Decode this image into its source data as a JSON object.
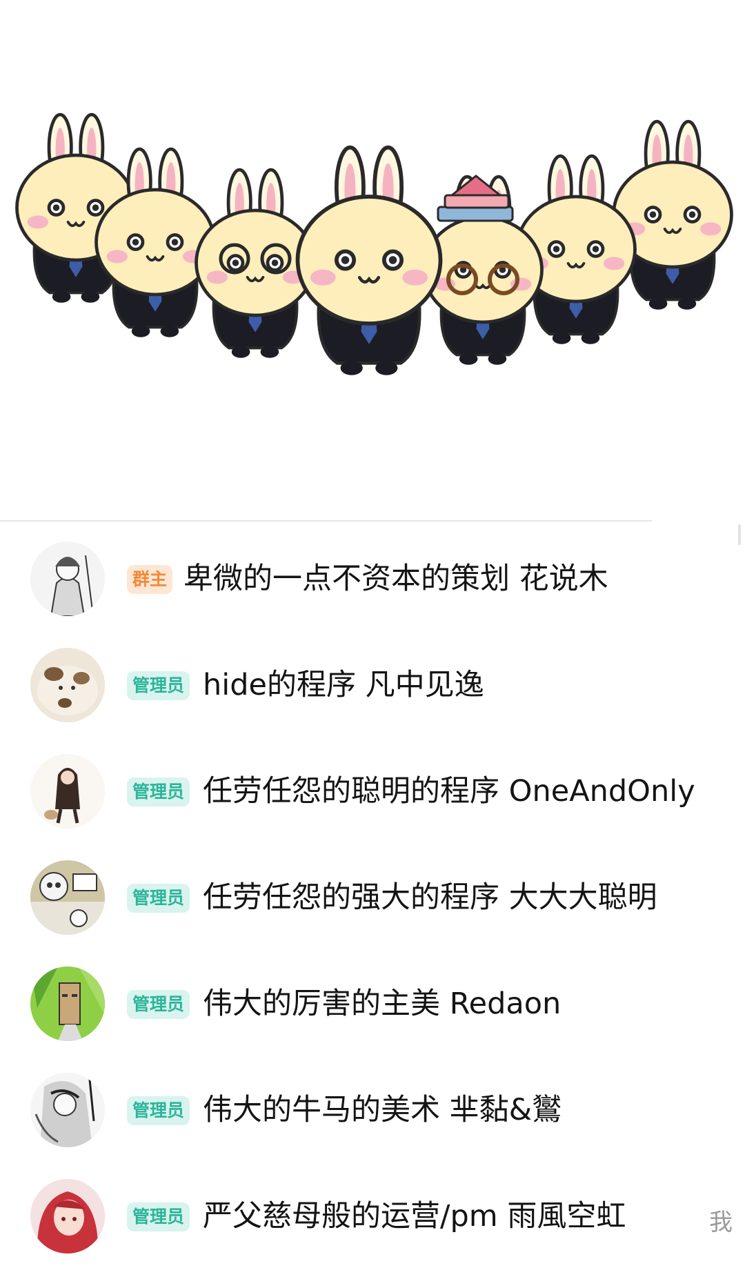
{
  "members": [
    {
      "badge": "群主",
      "badge_type": "owner",
      "name": "卑微的一点不资本的策划 花说木",
      "avatar": "sketch-guy-avatar"
    },
    {
      "badge": "管理员",
      "badge_type": "admin",
      "name": "hide的程序 凡中见逸",
      "avatar": "cat-avatar"
    },
    {
      "badge": "管理员",
      "badge_type": "admin",
      "name": "任劳任怨的聪明的程序 OneAndOnly",
      "avatar": "girl-with-cat-avatar"
    },
    {
      "badge": "管理员",
      "badge_type": "admin",
      "name": "任劳任怨的强大的程序 大大大聪明",
      "avatar": "comic-cat-avatar"
    },
    {
      "badge": "管理员",
      "badge_type": "admin",
      "name": "伟大的厉害的主美 Redaon",
      "avatar": "green-cartoon-avatar"
    },
    {
      "badge": "管理员",
      "badge_type": "admin",
      "name": "伟大的牛马的美术 芈黏&鸑",
      "avatar": "anime-sketch-avatar"
    },
    {
      "badge": "管理员",
      "badge_type": "admin",
      "name": "严父慈母般的运营/pm  雨風空虹",
      "avatar": "red-hair-avatar",
      "me_label": "我"
    }
  ],
  "colors": {
    "owner_badge_text": "#f08a3a",
    "owner_badge_bg": "#fde7d4",
    "admin_badge_text": "#2bb59a",
    "admin_badge_bg": "#d9f3ee"
  }
}
